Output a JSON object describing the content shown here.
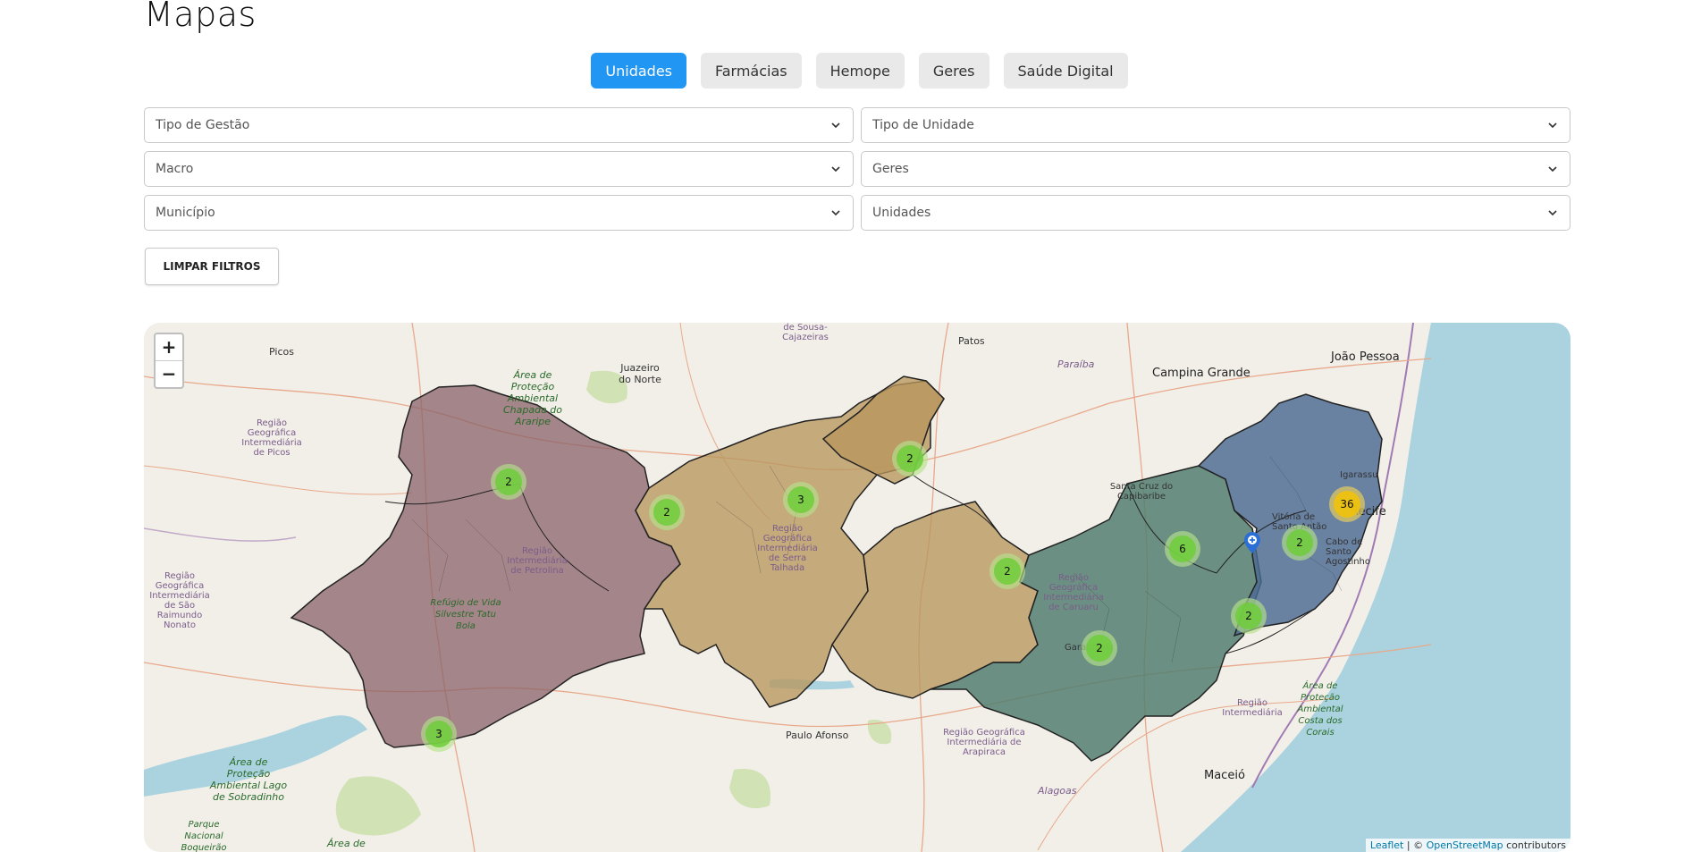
{
  "page": {
    "title": "Mapas"
  },
  "tabs": [
    {
      "label": "Unidades",
      "active": true
    },
    {
      "label": "Farmácias",
      "active": false
    },
    {
      "label": "Hemope",
      "active": false
    },
    {
      "label": "Geres",
      "active": false
    },
    {
      "label": "Saúde Digital",
      "active": false
    }
  ],
  "filters": {
    "tipo_gestao": {
      "placeholder": "Tipo de Gestão"
    },
    "tipo_unidade": {
      "placeholder": "Tipo de Unidade"
    },
    "macro": {
      "placeholder": "Macro"
    },
    "geres": {
      "placeholder": "Geres"
    },
    "municipio": {
      "placeholder": "Município"
    },
    "unidades": {
      "placeholder": "Unidades"
    },
    "clear_label": "LIMPAR FILTROS"
  },
  "map": {
    "zoom_in": "+",
    "zoom_out": "−",
    "clusters": [
      "2",
      "2",
      "3",
      "2",
      "2",
      "6",
      "36",
      "2",
      "2",
      "2",
      "3"
    ],
    "labels": {
      "picos": "Picos",
      "juazeiro": "Juazeiro do Norte",
      "sousa": "de Sousa-Cajazeiras",
      "patos": "Patos",
      "joao_pessoa": "João Pessoa",
      "campina_grande": "Campina Grande",
      "paraiba": "Paraíba",
      "santa_cruz": "Santa Cruz do Capibaribe",
      "igarassu": "Igarassu",
      "recife": "Recife",
      "vitoria": "Vitória de Santo Antão",
      "cabo": "Cabo de Santo Agostinho",
      "caruaru": "Região Geográfica Intermediária de Caruaru",
      "paulo_afonso": "Paulo Afonso",
      "arapiraca": "Região Geográfica Intermediária de Arapiraca",
      "alagoas": "Alagoas",
      "maceio": "Maceió",
      "reg_picos": "Região Geográfica Intermediária de Picos",
      "reg_sao_raimundo": "Região Geográfica Intermediária de São Raimundo Nonato",
      "reg_petrolina": "Região Intermediária de Petrolina",
      "reg_serra": "Região Geográfica Intermediária de Serra Talhada",
      "reg_regiao": "Região Intermediária",
      "apa_araripe": "Área de Proteção Ambiental Chapada do Araripe",
      "refugio": "Refúgio de Vida Silvestre Tatu Bola",
      "apa_sobradinho": "Área de Proteção Ambiental Lago de Sobradinho",
      "parque": "Parque Nacional Boqueirão",
      "area_de": "Área de",
      "apa_corais": "Área de Proteção Ambiental Costa dos Corais",
      "garanhuns": "Garanhuns"
    },
    "attribution": {
      "leaflet": "Leaflet",
      "separator": " | © ",
      "osm": "OpenStreetMap",
      "suffix": " contributors"
    },
    "colors": {
      "sertao": "#8a6168",
      "pajeu": "#b8965e",
      "agreste": "#4d7b6c",
      "metro": "#4b6a93",
      "sea": "#aad3df",
      "land": "#f2efe9"
    }
  }
}
